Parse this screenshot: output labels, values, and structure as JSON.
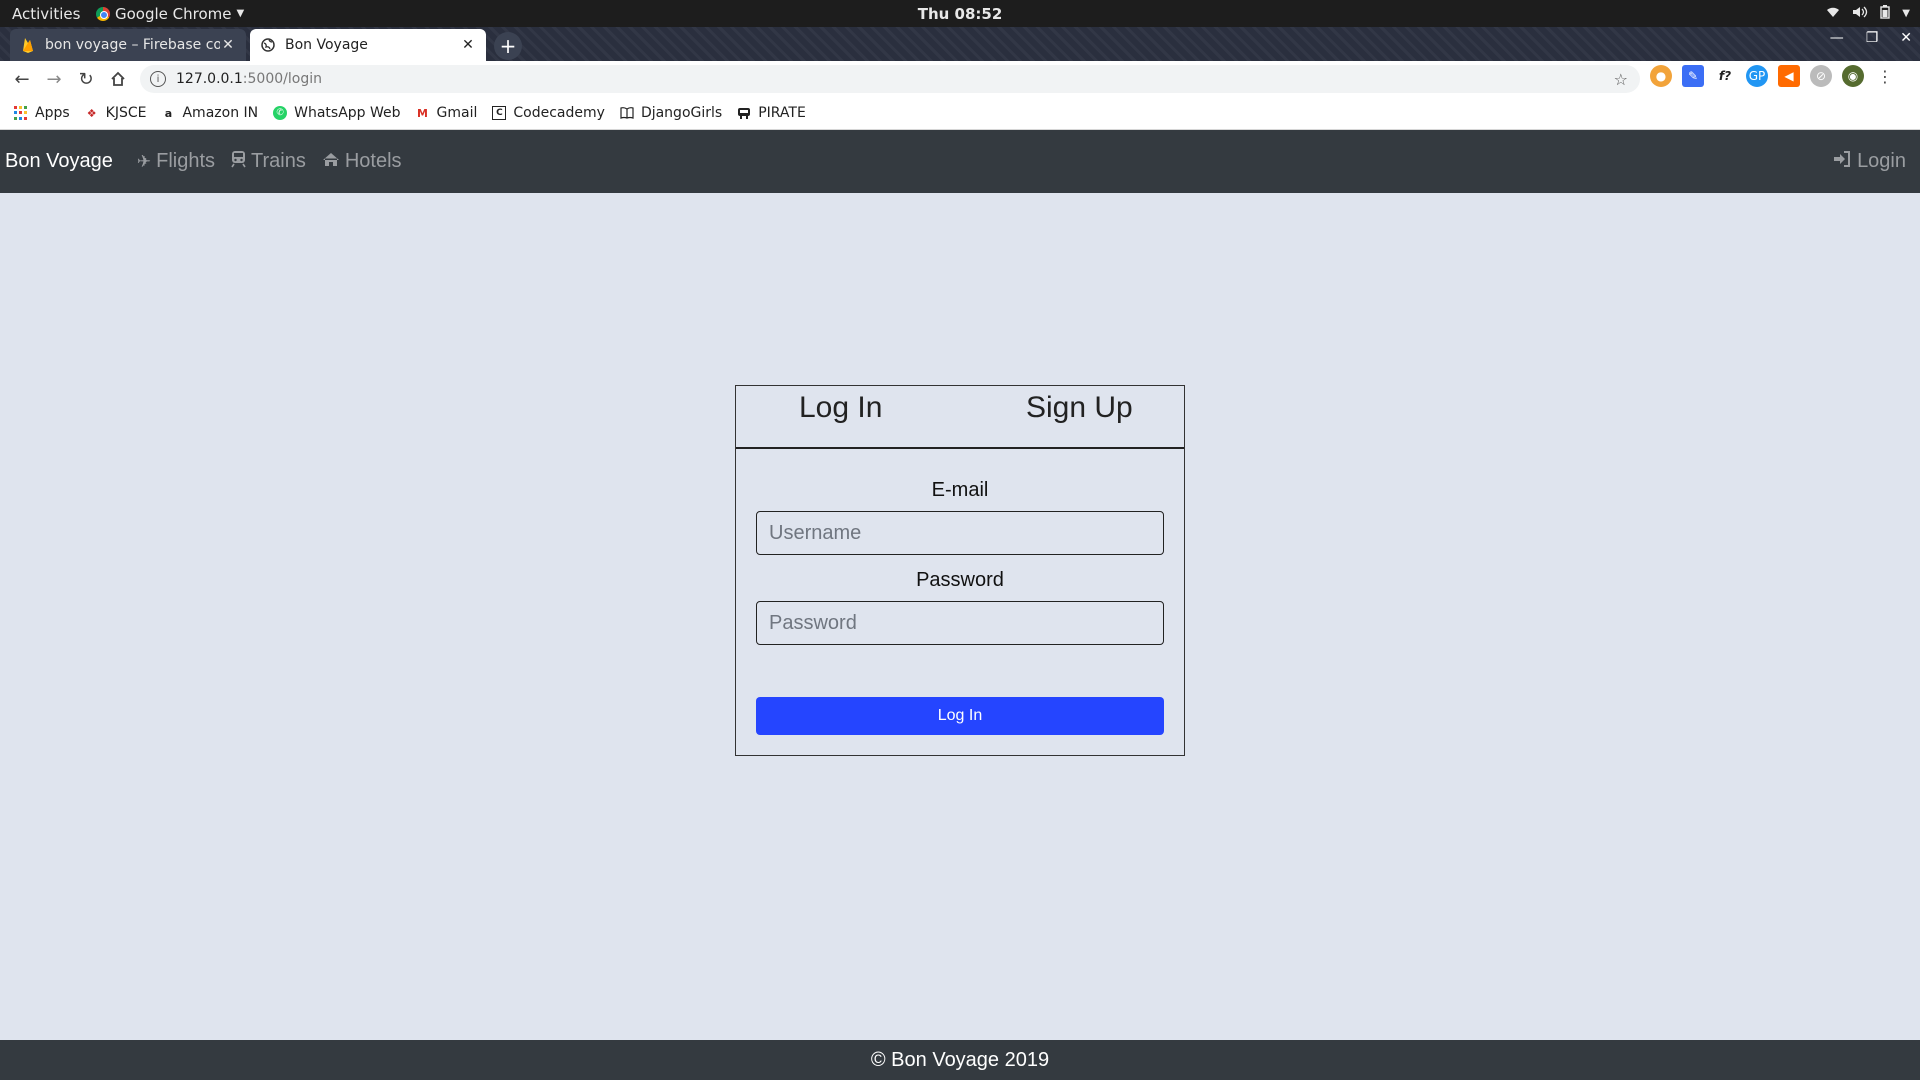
{
  "system_bar": {
    "activities": "Activities",
    "app_name": "Google Chrome",
    "clock": "Thu 08:52"
  },
  "browser": {
    "tabs": [
      {
        "title": "bon voyage – Firebase con",
        "favicon": "firebase-icon"
      },
      {
        "title": "Bon Voyage",
        "favicon": "globe-icon"
      }
    ],
    "url_host": "127.0.0.1",
    "url_path": ":5000/login",
    "bookmarks": [
      {
        "label": "Apps",
        "icon": "apps-grid-icon"
      },
      {
        "label": "KJSCE",
        "icon": "kjsce-icon"
      },
      {
        "label": "Amazon IN",
        "icon": "amazon-icon"
      },
      {
        "label": "WhatsApp Web",
        "icon": "whatsapp-icon"
      },
      {
        "label": "Gmail",
        "icon": "gmail-icon"
      },
      {
        "label": "Codecademy",
        "icon": "codecademy-icon"
      },
      {
        "label": "DjangoGirls",
        "icon": "book-icon"
      },
      {
        "label": "PIRATE",
        "icon": "pirate-icon"
      }
    ]
  },
  "navbar": {
    "brand": "Bon Voyage",
    "links": [
      {
        "label": "Flights",
        "icon": "plane-icon"
      },
      {
        "label": "Trains",
        "icon": "train-icon"
      },
      {
        "label": "Hotels",
        "icon": "home-icon"
      }
    ],
    "login": "Login"
  },
  "card": {
    "tab_login": "Log In",
    "tab_signup": "Sign Up",
    "email_label": "E-mail",
    "email_placeholder": "Username",
    "password_label": "Password",
    "password_placeholder": "Password",
    "submit": "Log In"
  },
  "footer": {
    "text": "© Bon Voyage 2019"
  },
  "colors": {
    "page_bg": "#dfe4ee",
    "navbar_bg": "#343a40",
    "button_primary": "#2545ff"
  }
}
